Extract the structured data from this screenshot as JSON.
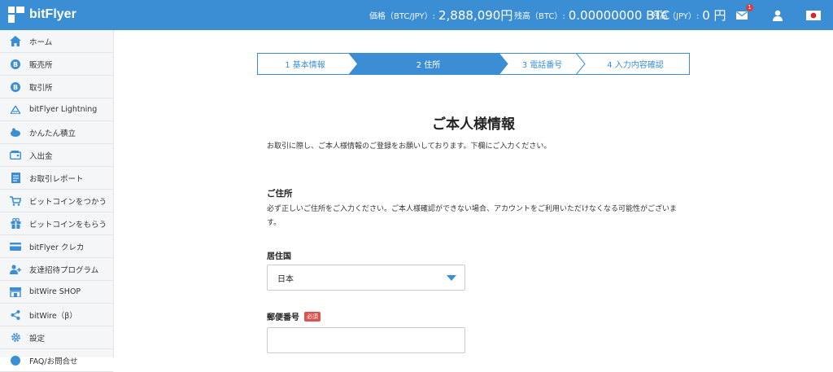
{
  "header": {
    "logo_text": "bitFlyer",
    "price_label": "価格（BTC/JPY）:",
    "price_value": "2,888,090円",
    "btc_balance_label": "残高（BTC）:",
    "btc_balance_value": "0.00000000 BTC",
    "jpy_balance_label": "残高（JPY）:",
    "jpy_balance_value": "0 円",
    "mail_badge": "1",
    "colors": {
      "bar": "#3b8ed4",
      "badge": "#e03b3b"
    },
    "icons": [
      "mail-icon",
      "user-icon",
      "japan-flag-icon"
    ]
  },
  "sidebar": {
    "items": [
      {
        "label": "ホーム",
        "icon": "home-icon"
      },
      {
        "label": "販売所",
        "icon": "bitcoin-icon"
      },
      {
        "label": "取引所",
        "icon": "bitcoin-icon"
      },
      {
        "label": "bitFlyer Lightning",
        "icon": "lightning-icon"
      },
      {
        "label": "かんたん積立",
        "icon": "piggy-bank-icon"
      },
      {
        "label": "入出金",
        "icon": "wallet-icon"
      },
      {
        "label": "お取引レポート",
        "icon": "report-icon"
      },
      {
        "label": "ビットコインをつかう",
        "icon": "cart-icon"
      },
      {
        "label": "ビットコインをもらう",
        "icon": "gift-icon"
      },
      {
        "label": "bitFlyer クレカ",
        "icon": "credit-card-icon"
      },
      {
        "label": "友達招待プログラム",
        "icon": "invite-icon"
      },
      {
        "label": "bitWire SHOP",
        "icon": "shop-icon"
      },
      {
        "label": "bitWire（β）",
        "icon": "share-icon"
      },
      {
        "label": "設定",
        "icon": "gear-icon"
      },
      {
        "label": "FAQ/お問合せ",
        "icon": "help-icon"
      }
    ]
  },
  "steps": [
    {
      "label": "1 基本情報",
      "active": false
    },
    {
      "label": "2 住所",
      "active": true
    },
    {
      "label": "3 電話番号",
      "active": false
    },
    {
      "label": "4 入力内容確認",
      "active": false
    }
  ],
  "main": {
    "title": "ご本人様情報",
    "lead": "お取引に際し、ご本人様情報のご登録をお願いしております。下欄にご入力ください。",
    "section_title": "ご住所",
    "note": "必ず正しいご住所をご入力ください。ご本人様確認ができない場合、アカウントをご利用いただけなくなる可能性がございます。",
    "country_label": "居住国",
    "country_value": "日本",
    "postal_label": "郵便番号",
    "required_badge": "必須",
    "postal_value": ""
  }
}
